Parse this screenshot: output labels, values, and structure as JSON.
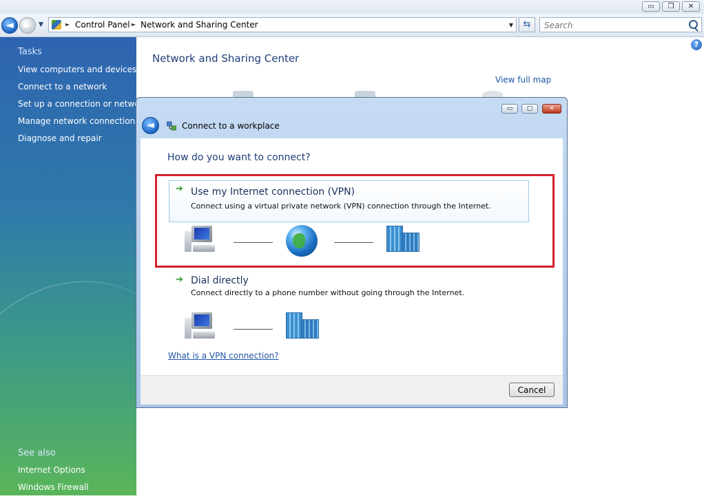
{
  "window": {
    "caption_buttons": {
      "minimize": "▭",
      "restore": "❐",
      "close": "✕"
    }
  },
  "nav": {
    "back_glyph": "◄",
    "forward_glyph": "►",
    "breadcrumbs": [
      "Control Panel",
      "Network and Sharing Center"
    ],
    "search_placeholder": "Search",
    "refresh_glyph": "⇆"
  },
  "sidebar": {
    "tasks_title": "Tasks",
    "tasks": [
      "View computers and devices",
      "Connect to a network",
      "Set up a connection or network",
      "Manage network connections",
      "Diagnose and repair"
    ],
    "see_also_title": "See also",
    "see_also": [
      "Internet Options",
      "Windows Firewall"
    ]
  },
  "main": {
    "title": "Network and Sharing Center",
    "view_full_map": "View full map",
    "help_glyph": "?"
  },
  "dialog": {
    "title": "Connect to a workplace",
    "back_glyph": "◄",
    "buttons": {
      "minimize": "▭",
      "maximize": "▢",
      "close": "✕"
    },
    "question": "How do you want to connect?",
    "options": [
      {
        "arrow": "➔",
        "title": "Use my Internet connection (VPN)",
        "description": "Connect using a virtual private network (VPN) connection through the Internet.",
        "highlighted": true
      },
      {
        "arrow": "➔",
        "title": "Dial directly",
        "description": "Connect directly to a phone number without going through the Internet.",
        "highlighted": false
      }
    ],
    "vpn_link": "What is a VPN connection?",
    "cancel_label": "Cancel"
  },
  "colors": {
    "highlight_border": "#d4202c",
    "link": "#1e55a5",
    "heading": "#1e3e78",
    "arrow_green": "#2e9a2e"
  }
}
